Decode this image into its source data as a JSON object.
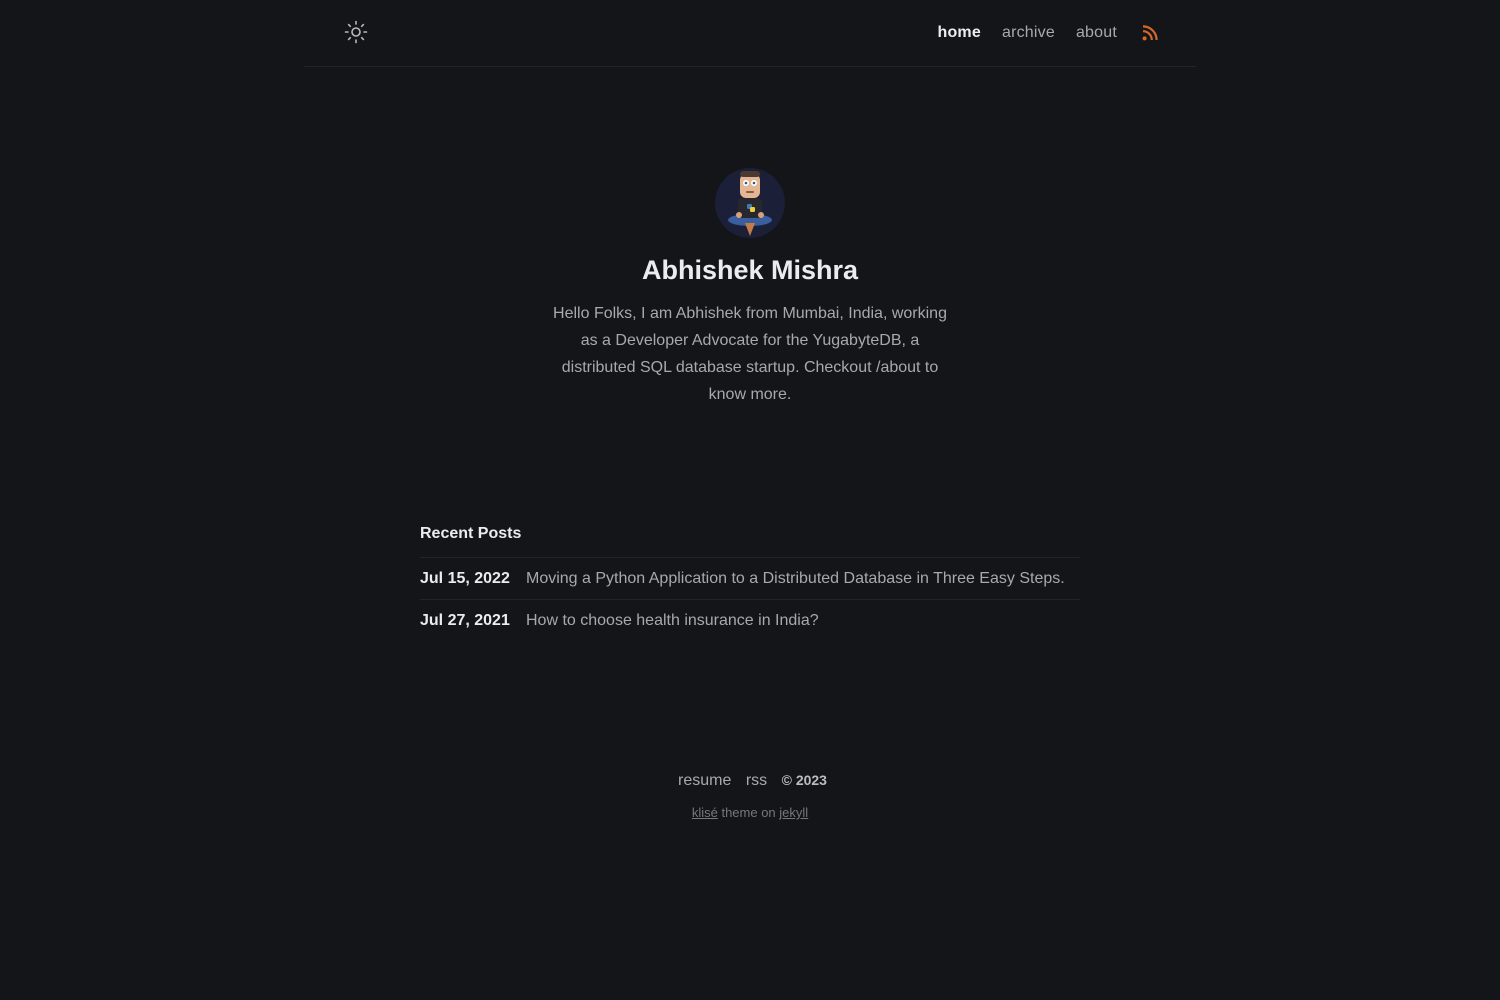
{
  "header": {
    "theme_toggle_icon": "sun-icon",
    "nav": {
      "home": "home",
      "archive": "archive",
      "about": "about"
    },
    "rss_icon": "rss-icon",
    "rss_color": "#d2692a"
  },
  "profile": {
    "name": "Abhishek Mishra",
    "bio": "Hello Folks, I am Abhishek from Mumbai, India, working as a Developer Advocate for the YugabyteDB, a distributed SQL database startup. Checkout /about to know more."
  },
  "recent_posts": {
    "title": "Recent Posts",
    "items": [
      {
        "date": "Jul 15, 2022",
        "title": "Moving a Python Application to a Distributed Database in Three Easy Steps."
      },
      {
        "date": "Jul 27, 2021",
        "title": "How to choose health insurance in India?"
      }
    ]
  },
  "footer": {
    "resume": "resume",
    "rss": "rss",
    "copyright": "© 2023",
    "theme_name": "klisé",
    "credit_middle": "theme on",
    "platform": "jekyll"
  },
  "colors": {
    "background": "#141519",
    "text": "#a9a9ad",
    "heading": "#ececef",
    "accent_rss": "#d2692a"
  }
}
